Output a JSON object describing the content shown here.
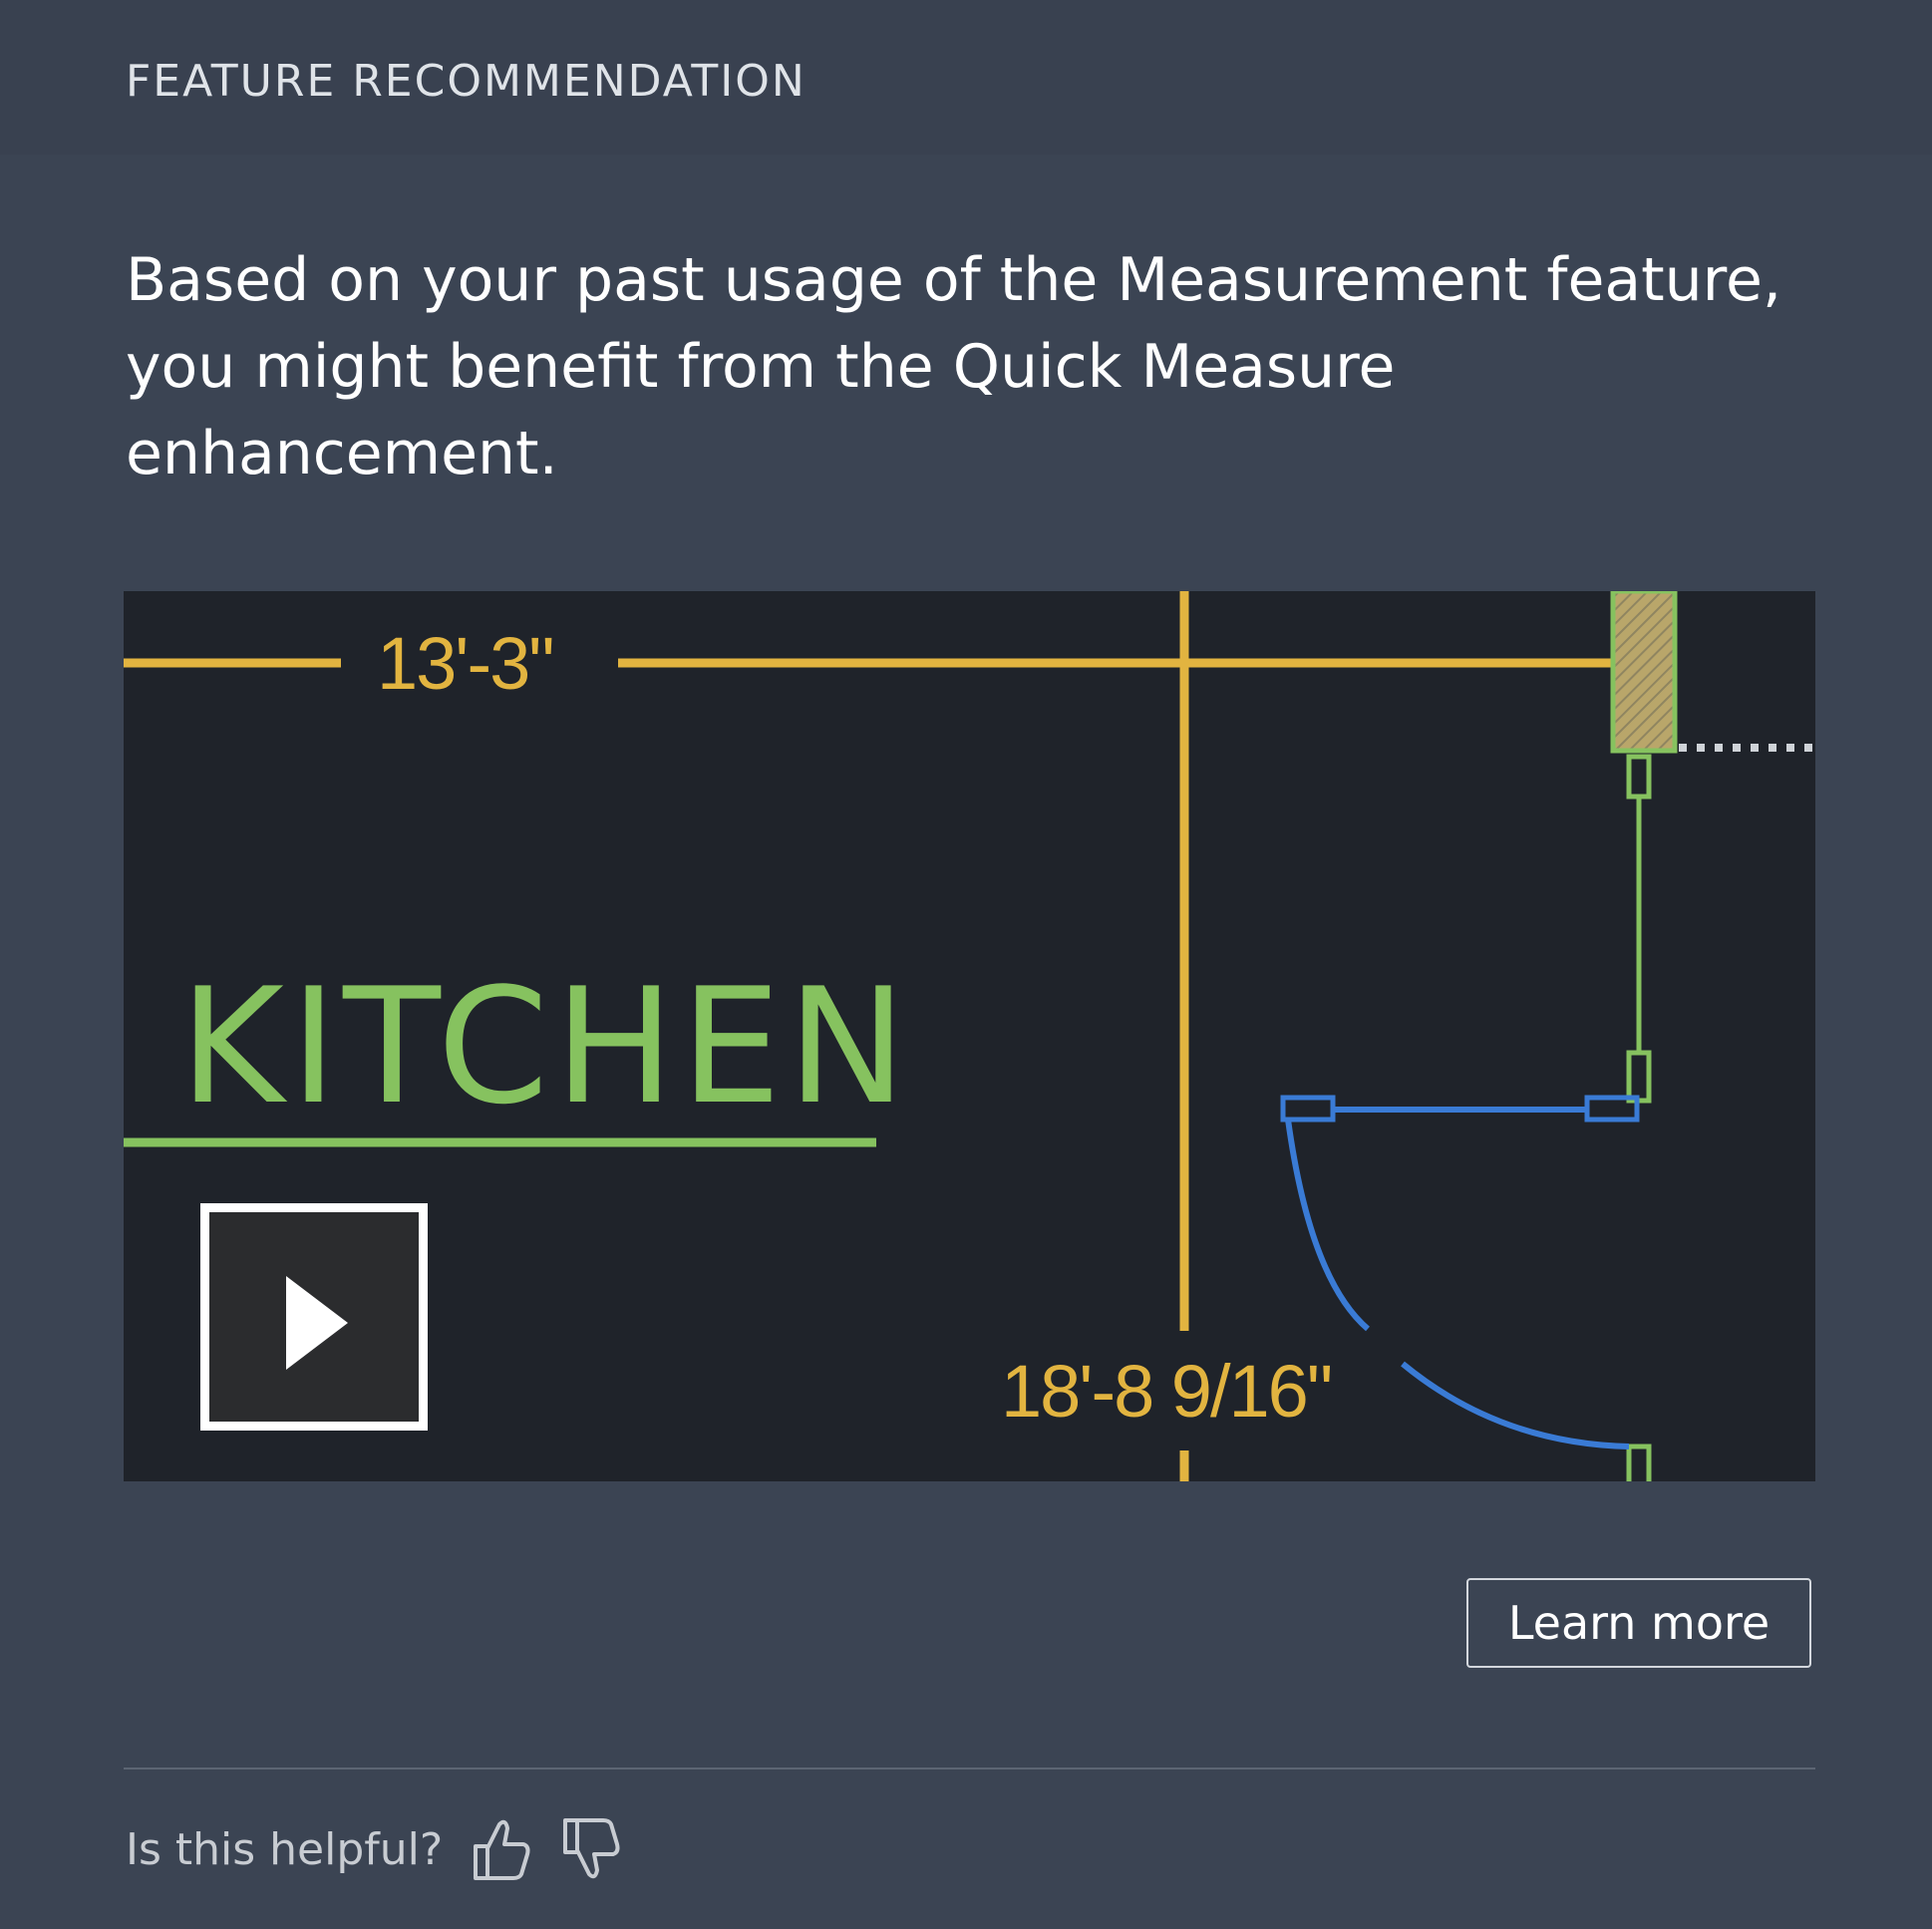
{
  "header": {
    "title": "FEATURE RECOMMENDATION"
  },
  "message": "Based on your past usage of the Measurement feature, you might benefit from the Quick Measure enhancement.",
  "media": {
    "dimension_top": "13'-3\"",
    "dimension_bottom": "18'-8 9/16\"",
    "room_label": "KITCHEN",
    "play_icon": "play-icon"
  },
  "actions": {
    "learn_more": "Learn more"
  },
  "feedback": {
    "question": "Is this helpful?",
    "thumbs_up_icon": "thumbs-up-icon",
    "thumbs_down_icon": "thumbs-down-icon"
  },
  "colors": {
    "background": "#3b4453",
    "media_bg": "#1f232a",
    "dimension": "#e2b440",
    "room": "#86c25f",
    "door": "#3a7bd5"
  }
}
